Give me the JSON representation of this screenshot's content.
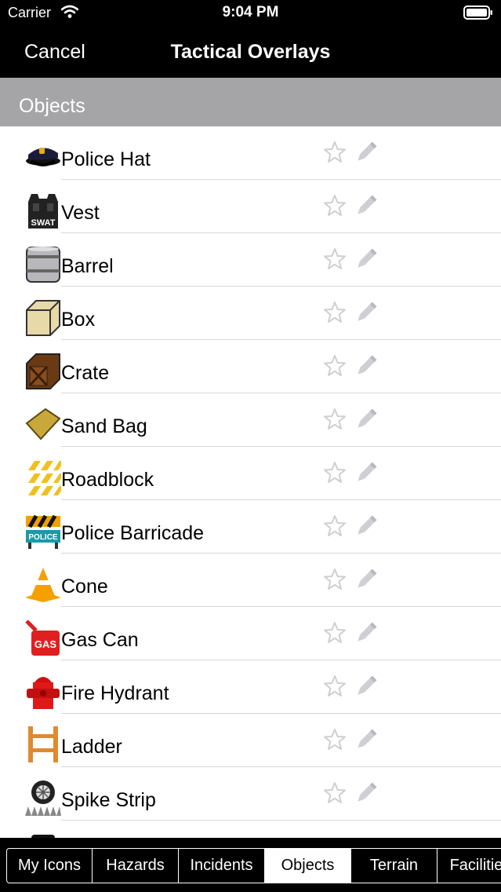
{
  "status": {
    "carrier": "Carrier",
    "time": "9:04 PM"
  },
  "nav": {
    "cancel_label": "Cancel",
    "title": "Tactical Overlays"
  },
  "section": {
    "title": "Objects"
  },
  "items": [
    {
      "label": "Police Hat",
      "icon": "police-hat-icon"
    },
    {
      "label": "Vest",
      "icon": "swat-vest-icon"
    },
    {
      "label": "Barrel",
      "icon": "barrel-icon"
    },
    {
      "label": "Box",
      "icon": "box-icon"
    },
    {
      "label": "Crate",
      "icon": "crate-icon"
    },
    {
      "label": "Sand Bag",
      "icon": "sand-bag-icon"
    },
    {
      "label": "Roadblock",
      "icon": "roadblock-icon"
    },
    {
      "label": "Police Barricade",
      "icon": "police-barricade-icon"
    },
    {
      "label": "Cone",
      "icon": "cone-icon"
    },
    {
      "label": "Gas Can",
      "icon": "gas-can-icon"
    },
    {
      "label": "Fire Hydrant",
      "icon": "fire-hydrant-icon"
    },
    {
      "label": "Ladder",
      "icon": "ladder-icon"
    },
    {
      "label": "Spike Strip",
      "icon": "spike-strip-icon"
    }
  ],
  "tabs": [
    {
      "label": "My Icons",
      "selected": false
    },
    {
      "label": "Hazards",
      "selected": false
    },
    {
      "label": "Incidents",
      "selected": false
    },
    {
      "label": "Objects",
      "selected": true
    },
    {
      "label": "Terrain",
      "selected": false
    },
    {
      "label": "Facilities",
      "selected": false
    }
  ],
  "colors": {
    "section_header": "#a5a5a8",
    "bar_background": "#000000",
    "action_icon": "#cfcfd3"
  }
}
